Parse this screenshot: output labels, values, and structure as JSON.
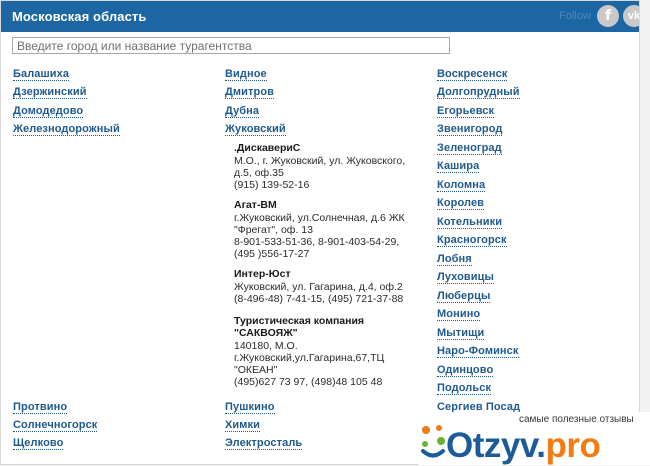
{
  "header": {
    "title": "Московская область",
    "follow": "Follow",
    "facebook_glyph": "f",
    "vk_glyph": "vk"
  },
  "search": {
    "placeholder": "Введите город или название турагентства",
    "value": ""
  },
  "columns": {
    "col1_top": [
      "Балашиха",
      "Дзержинский",
      "Домодедово",
      "Железнодорожный"
    ],
    "col2_top": [
      "Видное",
      "Дмитров",
      "Дубна",
      "Жуковский"
    ],
    "col3": [
      "Воскресенск",
      "Долгопрудный",
      "Егорьевск",
      "Звенигород",
      "Зеленоград",
      "Кашира",
      "Коломна",
      "Королев",
      "Котельники",
      "Красногорск",
      "Лобня",
      "Луховицы",
      "Люберцы",
      "Монино",
      "Мытищи",
      "Наро-Фоминск",
      "Одинцово",
      "Подольск",
      "Сергиев Посад"
    ],
    "col1_bottom": [
      "Протвино",
      "Солнечногорск",
      "Щелково"
    ],
    "col2_bottom": [
      "Пушкино",
      "Химки",
      "Электросталь"
    ]
  },
  "agencies": [
    {
      "name": ".ДискавериС",
      "lines": [
        "М.О., г. Жуковский, ул. Жуковского, д.5, оф.35",
        "(915) 139-52-16"
      ]
    },
    {
      "name": "Агат-ВМ",
      "lines": [
        "г.Жуковский, ул.Солнечная, д.6 ЖК \"Фрегат\", оф. 13",
        "8-901-533-51-36, 8-901-403-54-29, (495 )556-17-27"
      ]
    },
    {
      "name": "Интер-Юст",
      "lines": [
        "Жуковский, ул. Гагарина, д.4, оф.2",
        "(8-496-48) 7-41-15, (495) 721-37-88"
      ]
    },
    {
      "name": "Туристическая компания \"САКВОЯЖ\"",
      "lines": [
        "140180, М.О. г.Жуковский,ул.Гагарина,67,ТЦ \"ОКЕАН\"",
        "(495)627 73 97, (498)48 105 48"
      ]
    }
  ],
  "watermark": {
    "tagline": "самые полезные отзывы",
    "logo_main": "Otzyv",
    "logo_dot": ".",
    "logo_pro": "pro",
    "icon": "otzyv-logo-icon"
  },
  "colors": {
    "header_bg": "#1d66a4",
    "link": "#1f5a8f",
    "brand_blue": "#1c5a99",
    "brand_orange": "#f27b12"
  }
}
